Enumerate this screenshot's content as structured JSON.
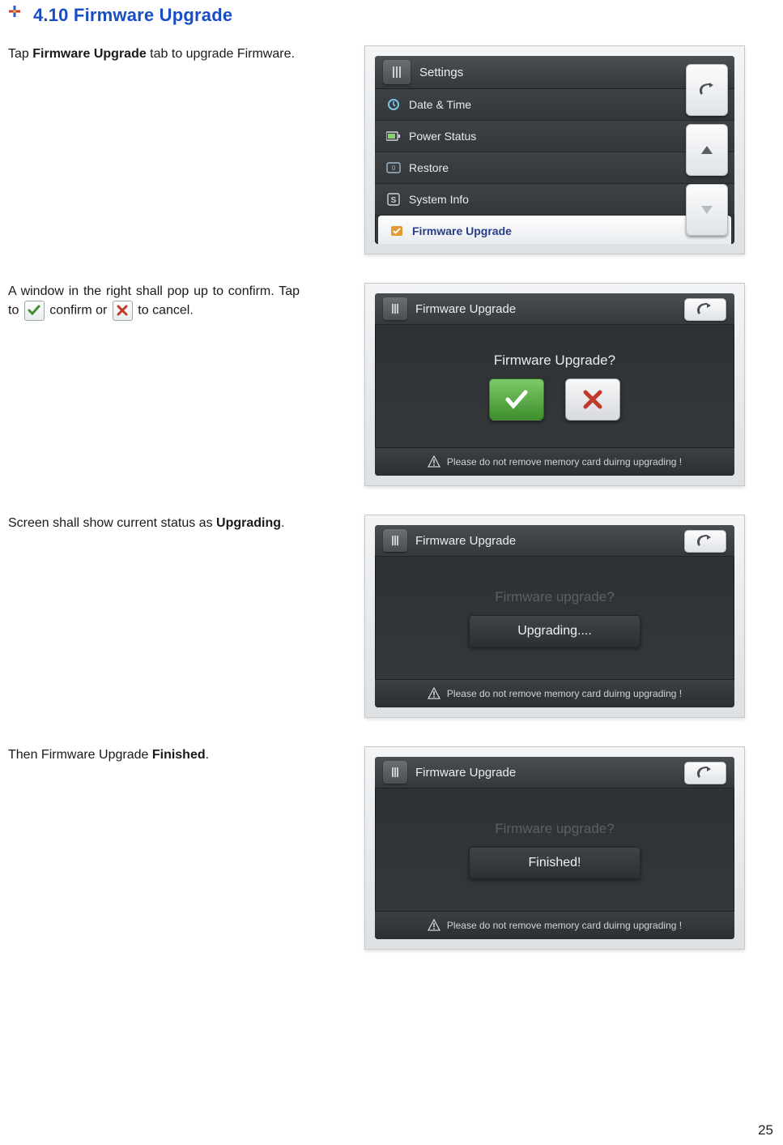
{
  "heading": "4.10 Firmware Upgrade",
  "page_number": "25",
  "step1": {
    "text_pre": "Tap ",
    "text_bold": "Firmware Upgrade",
    "text_post": " tab to upgrade Firmware."
  },
  "step2": {
    "line1_pre": "A window in the right shall pop up to confirm. Tap to ",
    "confirm_word": " confirm or ",
    "cancel_word": "  to cancel."
  },
  "step3": {
    "text_pre": "Screen shall show current status as ",
    "text_bold": "Upgrading",
    "text_post": "."
  },
  "step4": {
    "text_pre": "Then Firmware Upgrade ",
    "text_bold": "Finished",
    "text_post": "."
  },
  "shot1": {
    "header": "Settings",
    "items": [
      "Date & Time",
      "Power Status",
      "Restore",
      "System Info",
      "Firmware Upgrade"
    ]
  },
  "dlg": {
    "title": "Firmware Upgrade",
    "question": "Firmware Upgrade?",
    "question_faded": "Firmware upgrade?",
    "upgrading": "Upgrading....",
    "finished": "Finished!",
    "footer": "Please do not remove memory card duirng upgrading !"
  }
}
